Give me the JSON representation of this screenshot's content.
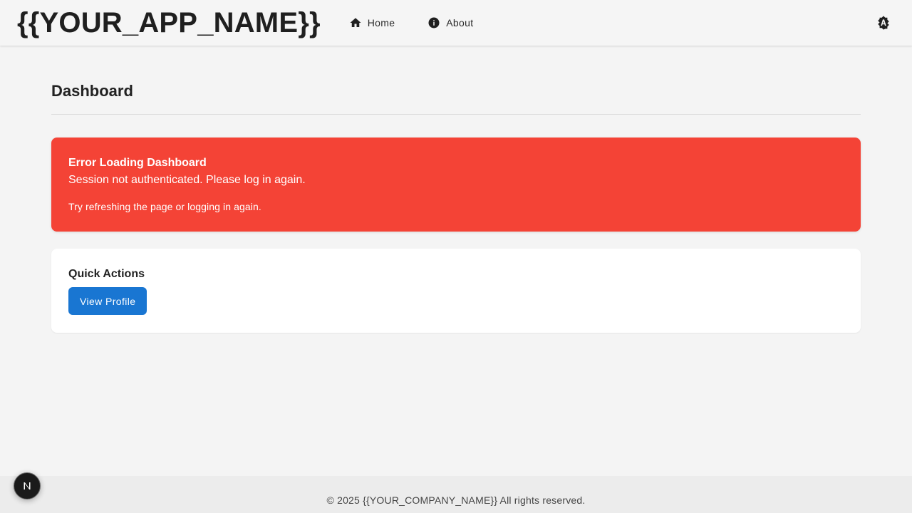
{
  "header": {
    "app_name": "{{YOUR_APP_NAME}}",
    "nav": [
      {
        "label": "Home",
        "icon": "home-icon"
      },
      {
        "label": "About",
        "icon": "info-icon"
      }
    ],
    "theme_toggle_icon": "brightness-auto-icon"
  },
  "main": {
    "title": "Dashboard",
    "error": {
      "title": "Error Loading Dashboard",
      "message": "Session not authenticated. Please log in again.",
      "hint": "Try refreshing the page or logging in again."
    },
    "quick_actions": {
      "title": "Quick Actions",
      "button_label": "View Profile"
    }
  },
  "footer": {
    "text": "© 2025 {{YOUR_COMPANY_NAME}} All rights reserved."
  },
  "dev_badge": {
    "letter": "N"
  },
  "colors": {
    "error": "#f44336",
    "primary": "#1976d2",
    "background": "#f4f4f4",
    "card": "#ffffff"
  }
}
